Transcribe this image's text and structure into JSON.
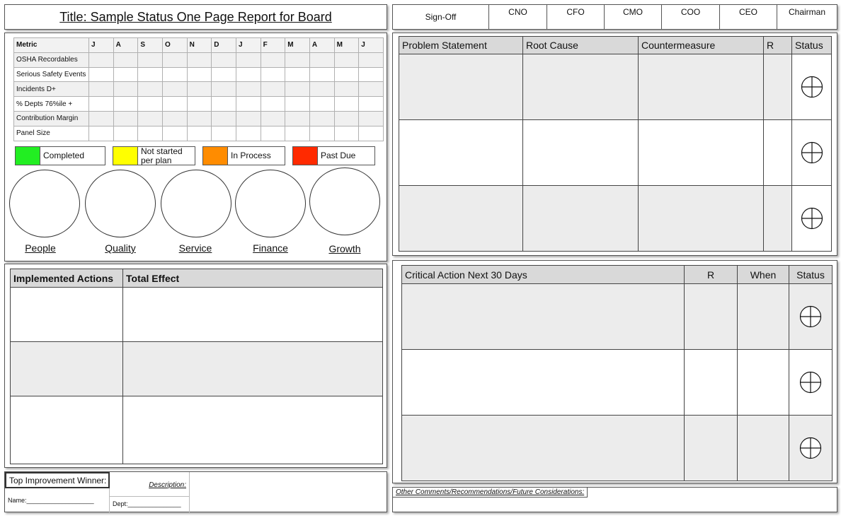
{
  "header": {
    "title": "Title:  Sample Status One Page Report for Board"
  },
  "signoff": {
    "label": "Sign-Off",
    "roles": [
      "CNO",
      "CFO",
      "CMO",
      "COO",
      "CEO",
      "Chairman"
    ]
  },
  "metrics": {
    "header_label": "Metric",
    "months": [
      "J",
      "A",
      "S",
      "O",
      "N",
      "D",
      "J",
      "F",
      "M",
      "A",
      "M",
      "J"
    ],
    "rows": [
      "OSHA Recordables",
      "Serious Safety Events",
      "Incidents D+",
      "% Depts 76%ile +",
      "Contribution Margin",
      "Panel Size"
    ]
  },
  "legend": [
    {
      "label": "Completed",
      "color": "#22ee22"
    },
    {
      "label": "Not started per plan",
      "color": "#ffff00"
    },
    {
      "label": "In Process",
      "color": "#ff8c00"
    },
    {
      "label": "Past Due",
      "color": "#ff2a00"
    }
  ],
  "pillars": [
    "People",
    "Quality",
    "Service",
    "Finance",
    "Growth"
  ],
  "implemented": {
    "col_actions": "Implemented Actions",
    "col_effect": "Total Effect"
  },
  "winner": {
    "title": "Top Improvement Winner:",
    "name_label": "Name:___________________",
    "description_label": "Description:",
    "dept_label": "Dept:_______________"
  },
  "problem": {
    "columns": [
      "Problem Statement",
      "Root Cause",
      "Countermeasure",
      "R",
      "Status"
    ]
  },
  "critical": {
    "columns": [
      "Critical Action Next 30 Days",
      "R",
      "When",
      "Status"
    ]
  },
  "comments": {
    "label": "Other Comments/Recommendations/Future Considerations:"
  },
  "icons": {
    "status": "status-crosshair-icon"
  }
}
